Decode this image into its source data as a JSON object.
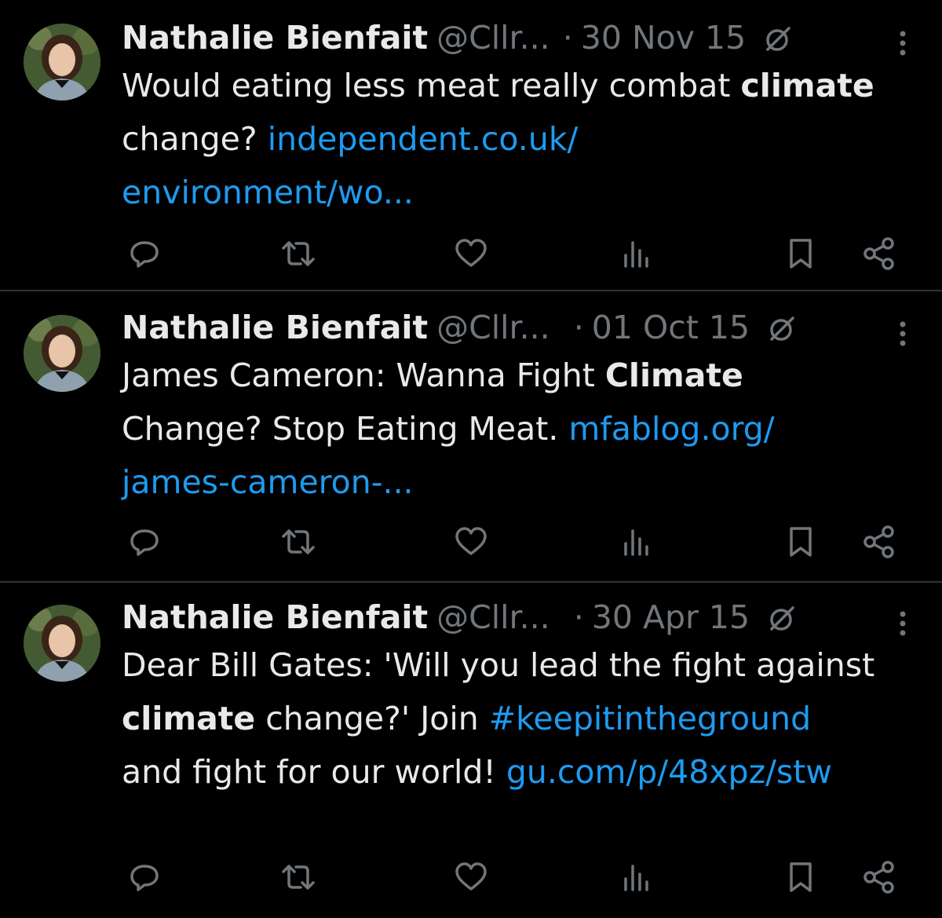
{
  "tweets": [
    {
      "name": "Nathalie Bienfait",
      "handle": "@Cllr...",
      "dot": "·",
      "date": "30 Nov 15",
      "text_plain_1": "Would eating less meat really combat ",
      "text_bold": "climate",
      "text_plain_2": " change? ",
      "link": "independent.co.uk/ environment/wo..."
    },
    {
      "name": "Nathalie Bienfait",
      "handle": "@Cllr...",
      "dot": "·",
      "date": "01 Oct 15",
      "text_plain_1": "James Cameron: Wanna Fight ",
      "text_bold": "Climate",
      "text_plain_2": " Change? Stop Eating Meat. ",
      "link": "mfablog.org/ james-cameron-..."
    },
    {
      "name": "Nathalie Bienfait",
      "handle": "@Cllr...",
      "dot": "·",
      "date": "30 Apr 15",
      "text_plain_1": "Dear Bill Gates: 'Will you lead the fight against ",
      "text_bold": "climate",
      "text_plain_2": " change?' Join ",
      "hashtag": "#keepitintheground",
      "text_plain_3": " and fight for our world! ",
      "link": "gu.com/p/48xpz/stw"
    }
  ],
  "icons": {
    "reply": "reply-icon",
    "retweet": "retweet-icon",
    "like": "like-icon",
    "views": "views-icon",
    "bookmark": "bookmark-icon",
    "share": "share-icon",
    "more": "more-icon",
    "grok": "grok-icon"
  },
  "colors": {
    "background": "#000000",
    "text": "#e7e9ea",
    "secondary": "#71767b",
    "link": "#1d9bf0",
    "divider": "#2f3336"
  }
}
